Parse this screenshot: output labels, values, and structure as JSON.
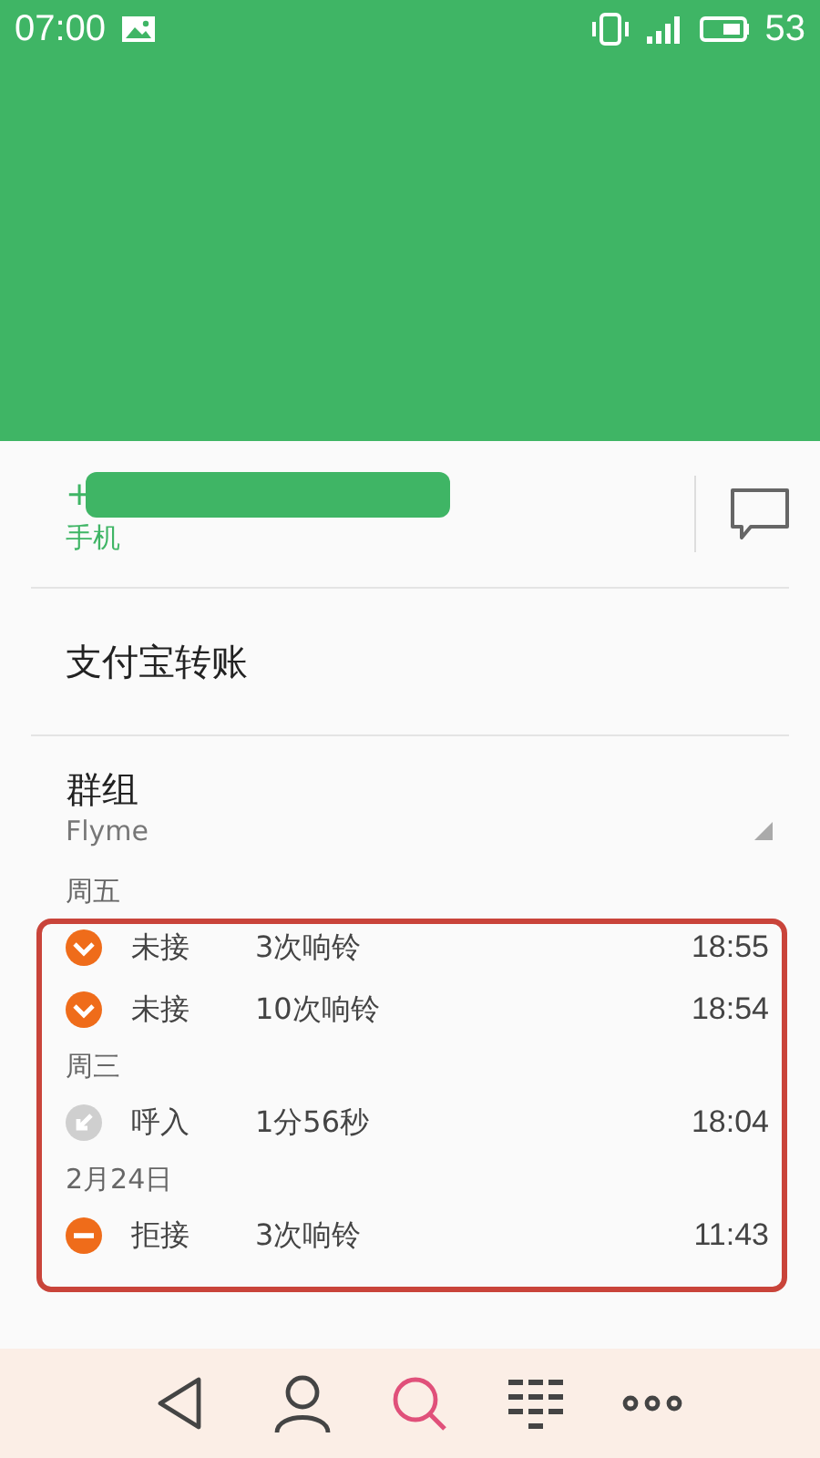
{
  "status_bar": {
    "time": "07:00",
    "battery": "53"
  },
  "phone": {
    "number_prefix": "+",
    "label": "手机"
  },
  "actions": [
    {
      "label": "支付宝转账"
    }
  ],
  "group": {
    "title": "群组",
    "value": "Flyme"
  },
  "call_log": [
    {
      "date": "周五",
      "calls": [
        {
          "kind": "missed",
          "type": "未接",
          "detail": "3次响铃",
          "time": "18:55"
        },
        {
          "kind": "missed",
          "type": "未接",
          "detail": "10次响铃",
          "time": "18:54"
        }
      ]
    },
    {
      "date": "周三",
      "calls": [
        {
          "kind": "incoming",
          "type": "呼入",
          "detail": "1分56秒",
          "time": "18:04"
        }
      ]
    },
    {
      "date": "2月24日",
      "calls": [
        {
          "kind": "rejected",
          "type": "拒接",
          "detail": "3次响铃",
          "time": "11:43"
        }
      ]
    }
  ],
  "nav": [
    {
      "kind": "back",
      "selected": false
    },
    {
      "kind": "contacts",
      "selected": false
    },
    {
      "kind": "search",
      "selected": true
    },
    {
      "kind": "dialpad",
      "selected": false
    },
    {
      "kind": "more",
      "selected": false
    }
  ]
}
